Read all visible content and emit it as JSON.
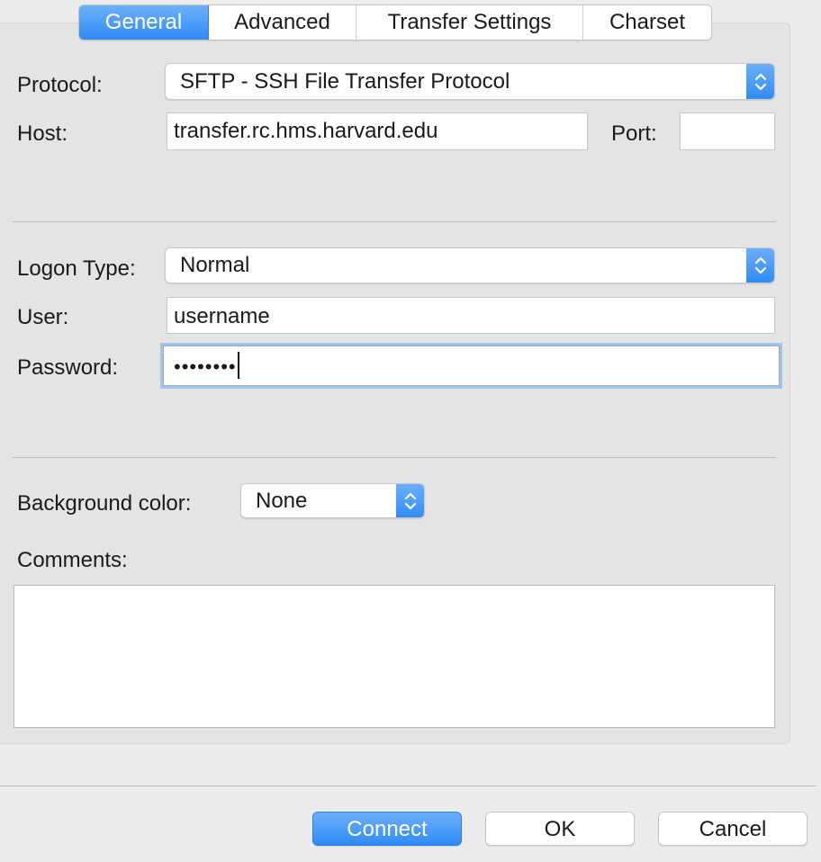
{
  "tabs": [
    {
      "label": "General",
      "active": true
    },
    {
      "label": "Advanced",
      "active": false
    },
    {
      "label": "Transfer Settings",
      "active": false
    },
    {
      "label": "Charset",
      "active": false
    }
  ],
  "general": {
    "protocol_label": "Protocol:",
    "protocol_value": "SFTP - SSH File Transfer Protocol",
    "host_label": "Host:",
    "host_value": "transfer.rc.hms.harvard.edu",
    "port_label": "Port:",
    "port_value": "",
    "logon_type_label": "Logon Type:",
    "logon_type_value": "Normal",
    "user_label": "User:",
    "user_value": "username",
    "password_label": "Password:",
    "password_value": "••••••••",
    "bg_color_label": "Background color:",
    "bg_color_value": "None",
    "comments_label": "Comments:",
    "comments_value": ""
  },
  "buttons": {
    "connect": "Connect",
    "ok": "OK",
    "cancel": "Cancel"
  },
  "colors": {
    "accent": "#2f8bf6",
    "focus_ring": "#9ec4ef",
    "panel": "#e4e4e4",
    "window": "#ececec"
  },
  "icons": {
    "stepper": "up-down-chevron-icon"
  }
}
